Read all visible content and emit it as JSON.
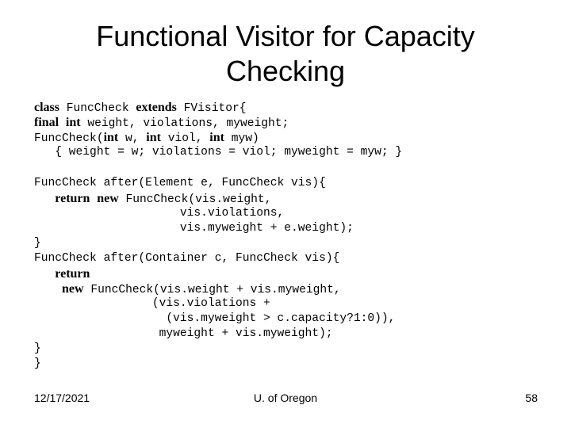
{
  "slide": {
    "title_lines": [
      "Functional Visitor for Capacity",
      "Checking"
    ],
    "code_lines": [
      [
        {
          "t": "class",
          "b": true
        },
        {
          "t": " FuncCheck "
        },
        {
          "t": "extends",
          "b": true
        },
        {
          "t": " FVisitor{"
        }
      ],
      [
        {
          "t": "final",
          "b": true
        },
        {
          "t": " "
        },
        {
          "t": "int",
          "b": true
        },
        {
          "t": " weight, violations, myweight;"
        }
      ],
      [
        {
          "t": "FuncCheck("
        },
        {
          "t": "int",
          "b": true
        },
        {
          "t": " w, "
        },
        {
          "t": "int",
          "b": true
        },
        {
          "t": " viol, "
        },
        {
          "t": "int",
          "b": true
        },
        {
          "t": " myw)"
        }
      ],
      [
        {
          "t": "   { weight = w; violations = viol; myweight = myw; }"
        }
      ],
      [
        {
          "t": ""
        }
      ],
      [
        {
          "t": "FuncCheck after(Element e, FuncCheck vis){"
        }
      ],
      [
        {
          "t": "   "
        },
        {
          "t": "return",
          "b": true
        },
        {
          "t": " "
        },
        {
          "t": "new",
          "b": true
        },
        {
          "t": " FuncCheck(vis.weight,"
        }
      ],
      [
        {
          "t": "                     vis.violations,"
        }
      ],
      [
        {
          "t": "                     vis.myweight + e.weight);"
        }
      ],
      [
        {
          "t": "}"
        }
      ],
      [
        {
          "t": "FuncCheck after(Container c, FuncCheck vis){"
        }
      ],
      [
        {
          "t": "   "
        },
        {
          "t": "return",
          "b": true
        }
      ],
      [
        {
          "t": "    "
        },
        {
          "t": "new",
          "b": true
        },
        {
          "t": " FuncCheck(vis.weight + vis.myweight,"
        }
      ],
      [
        {
          "t": "                 (vis.violations +"
        }
      ],
      [
        {
          "t": "                   (vis.myweight > c.capacity?1:0)),"
        }
      ],
      [
        {
          "t": "                  myweight + vis.myweight);"
        }
      ],
      [
        {
          "t": "}"
        }
      ],
      [
        {
          "t": "}"
        }
      ]
    ],
    "footer": {
      "date": "12/17/2021",
      "center": "U. of Oregon",
      "page_number": "58"
    }
  }
}
